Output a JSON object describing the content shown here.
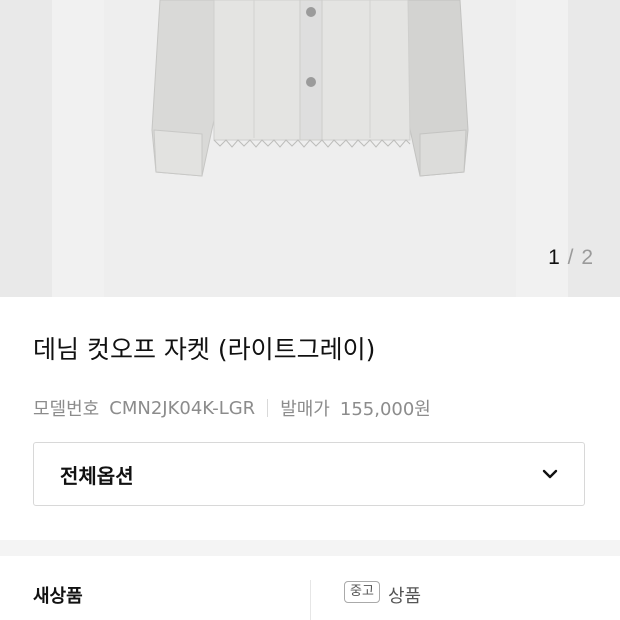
{
  "gallery": {
    "current_index": "1",
    "separator": "/",
    "total": "2"
  },
  "product": {
    "title": "데님 컷오프 자켓 (라이트그레이)",
    "model_label": "모델번호",
    "model_number": "CMN2JK04K-LGR",
    "price_label": "발매가",
    "price": "155,000원"
  },
  "options": {
    "label": "전체옵션",
    "icon": "chevron-down-icon"
  },
  "tabs": [
    {
      "label": "새상품",
      "badge": ""
    },
    {
      "label": "상품",
      "badge": "중고"
    }
  ]
}
